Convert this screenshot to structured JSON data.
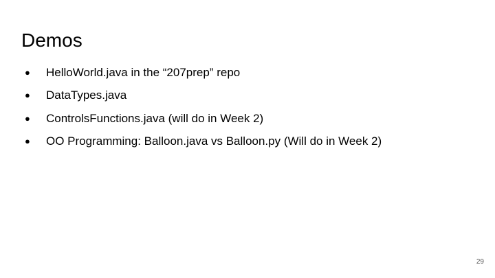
{
  "slide": {
    "title": "Demos",
    "bullet_symbol": "●",
    "bullets": [
      "HelloWorld.java in the “207prep” repo",
      "DataTypes.java",
      "ControlsFunctions.java (will do in Week 2)",
      "OO Programming: Balloon.java vs Balloon.py (Will do in Week 2)"
    ],
    "page_number": "29"
  }
}
